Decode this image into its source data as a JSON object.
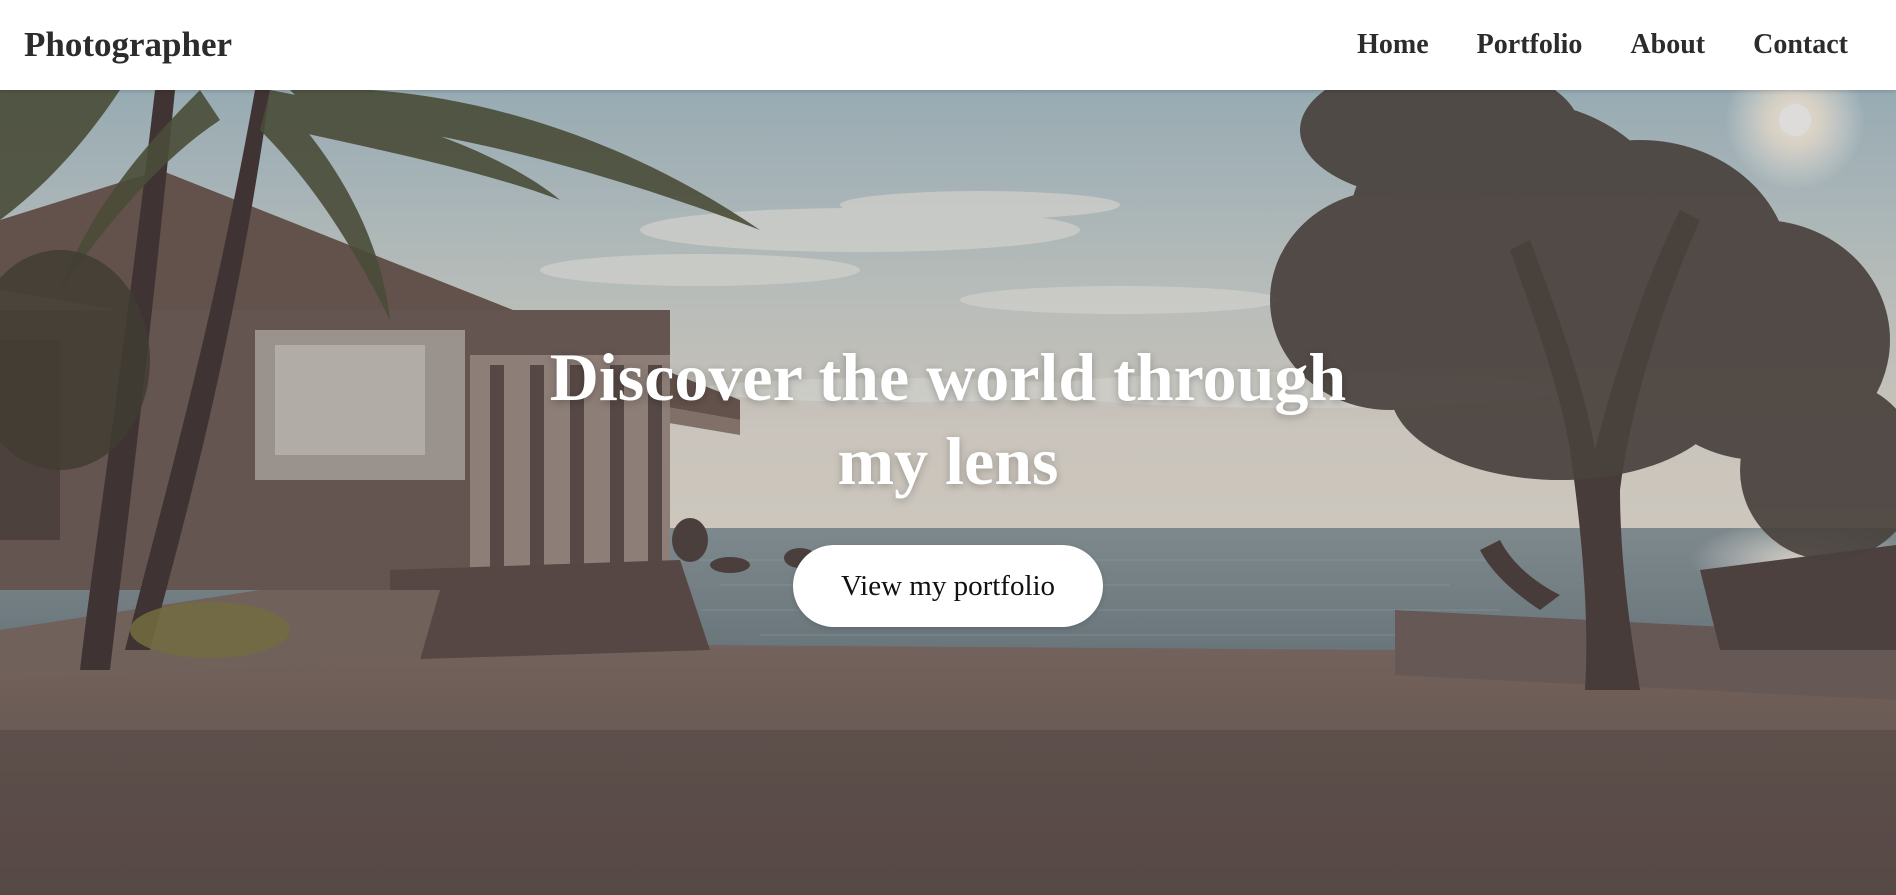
{
  "header": {
    "logo": "Photographer",
    "nav": [
      {
        "label": "Home"
      },
      {
        "label": "Portfolio"
      },
      {
        "label": "About"
      },
      {
        "label": "Contact"
      }
    ]
  },
  "hero": {
    "title": "Discover the world through my lens",
    "button_label": "View my portfolio",
    "background_description_icon": "beach-house-photo"
  },
  "colors": {
    "header_bg": "#ffffff",
    "nav_text": "#2c2c2c",
    "hero_text": "#ffffff",
    "button_bg": "#ffffff"
  }
}
